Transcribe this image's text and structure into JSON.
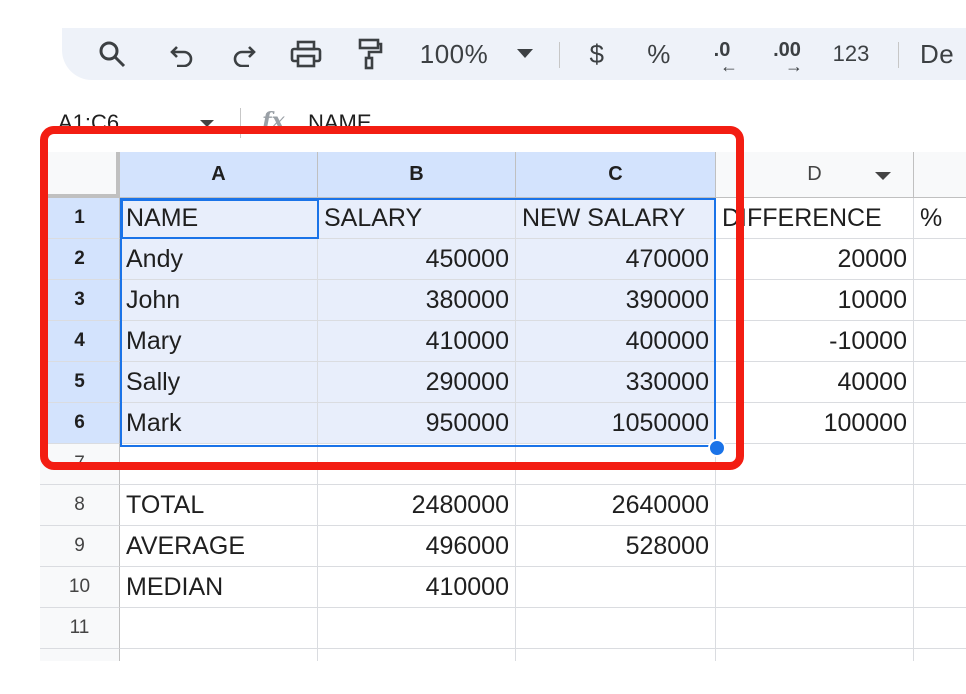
{
  "toolbar": {
    "zoom": "100%",
    "currency": "$",
    "percent": "%",
    "decrease_decimal": ".0",
    "increase_decimal": ".00",
    "number_format": "123",
    "default_font_partial": "De",
    "icons": [
      "search-icon",
      "undo-icon",
      "redo-icon",
      "print-icon",
      "paint-format-icon",
      "chevron-down-icon"
    ]
  },
  "formula_bar": {
    "name_box": "A1:C6",
    "fx": "fx",
    "value": "NAME"
  },
  "columns": [
    "A",
    "B",
    "C",
    "D"
  ],
  "rows": [
    "1",
    "2",
    "3",
    "4",
    "5",
    "6",
    "7",
    "8",
    "9",
    "10",
    "11"
  ],
  "cells": {
    "r1": [
      "NAME",
      "SALARY",
      "NEW SALARY",
      "DIFFERENCE",
      "%"
    ],
    "r2": [
      "Andy",
      "450000",
      "470000",
      "20000"
    ],
    "r3": [
      "John",
      "380000",
      "390000",
      "10000"
    ],
    "r4": [
      "Mary",
      "410000",
      "400000",
      "-10000"
    ],
    "r5": [
      "Sally",
      "290000",
      "330000",
      "40000"
    ],
    "r6": [
      "Mark",
      "950000",
      "1050000",
      "100000"
    ],
    "r8": [
      "TOTAL",
      "2480000",
      "2640000"
    ],
    "r9": [
      "AVERAGE",
      "496000",
      "528000"
    ],
    "r10": [
      "MEDIAN",
      "410000"
    ]
  },
  "colors": {
    "selection": "#1a73e8",
    "selected_header": "#d3e3fd",
    "annotation": "#f31d12"
  }
}
